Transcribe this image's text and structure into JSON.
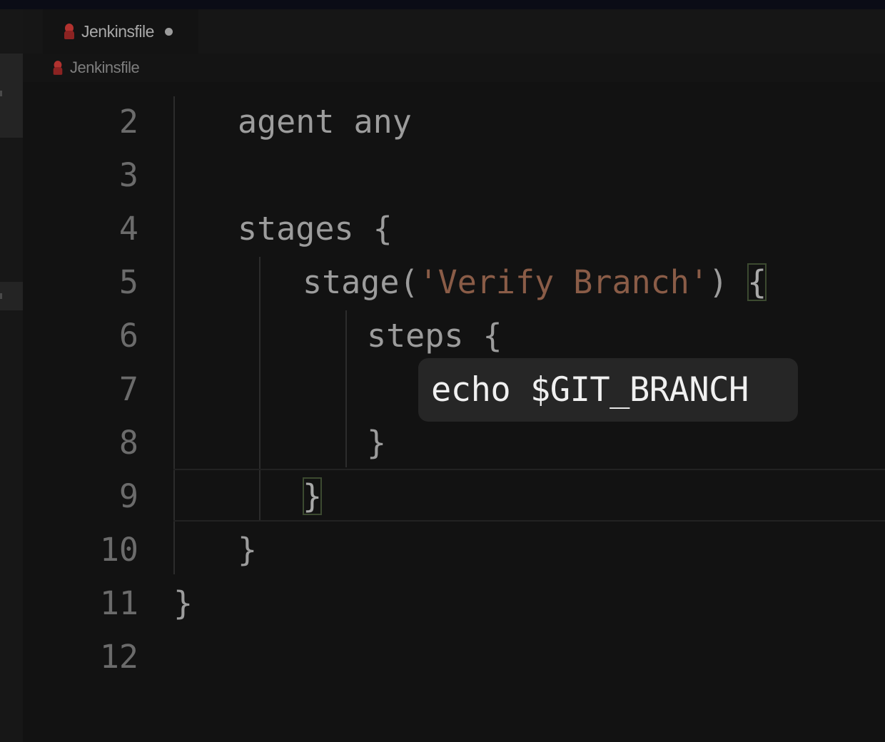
{
  "tab": {
    "filename": "Jenkinsfile",
    "dirty": true
  },
  "breadcrumb": {
    "file": "Jenkinsfile"
  },
  "editor": {
    "lines": [
      {
        "num": "2",
        "text": "agent any"
      },
      {
        "num": "3",
        "text": ""
      },
      {
        "num": "4",
        "text": "stages {"
      },
      {
        "num": "5",
        "pre": "stage(",
        "str": "'Verify Branch'",
        "post": ") ",
        "bracket": "{"
      },
      {
        "num": "6",
        "text": "steps {"
      },
      {
        "num": "7",
        "text": ""
      },
      {
        "num": "8",
        "text": "}"
      },
      {
        "num": "9",
        "bracket": "}"
      },
      {
        "num": "10",
        "text": "}"
      },
      {
        "num": "11",
        "text": "}"
      },
      {
        "num": "12",
        "text": ""
      }
    ]
  },
  "popup": {
    "text": "echo $GIT_BRANCH"
  },
  "colors": {
    "background": "#121212",
    "line_number": "#6b6b6b",
    "code_text": "#9c9c9c",
    "string": "#8a5c47",
    "popup_background": "#262626",
    "popup_text": "#f0f0f0",
    "jenkins_icon": "#b2322f"
  }
}
